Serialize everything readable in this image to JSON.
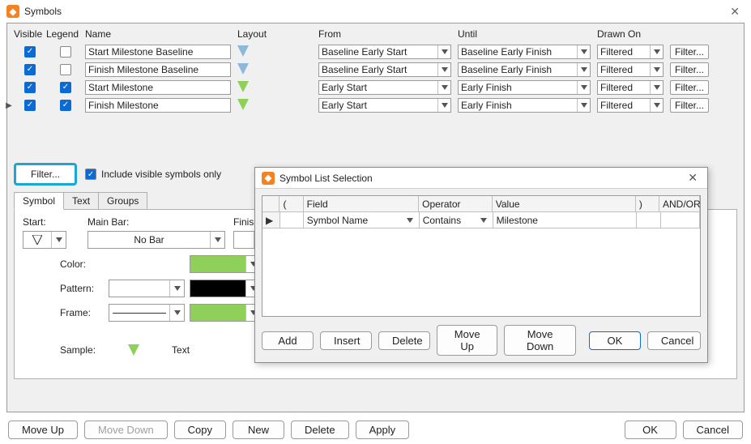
{
  "window": {
    "title": "Symbols",
    "close_icon": "✕"
  },
  "grid": {
    "headers": {
      "visible": "Visible",
      "legend": "Legend",
      "name": "Name",
      "layout": "Layout",
      "from": "From",
      "until": "Until",
      "drawn": "Drawn On"
    },
    "filter_btn": "Filter...",
    "rows": [
      {
        "visible": true,
        "legend": false,
        "name": "Start Milestone Baseline",
        "layout_color": "#8cb9d9",
        "from": "Baseline Early Start",
        "until": "Baseline Early Finish",
        "drawn": "Filtered"
      },
      {
        "visible": true,
        "legend": false,
        "name": "Finish Milestone Baseline",
        "layout_color": "#8cb9d9",
        "from": "Baseline Early Start",
        "until": "Baseline Early Finish",
        "drawn": "Filtered"
      },
      {
        "visible": true,
        "legend": true,
        "name": "Start Milestone",
        "layout_color": "#8ed05a",
        "from": "Early Start",
        "until": "Early Finish",
        "drawn": "Filtered"
      },
      {
        "visible": true,
        "legend": true,
        "name": "Finish Milestone",
        "layout_color": "#8ed05a",
        "from": "Early Start",
        "until": "Early Finish",
        "drawn": "Filtered"
      }
    ]
  },
  "filter": {
    "button": "Filter...",
    "include_label": "Include visible symbols only",
    "include_checked": true
  },
  "tabs": {
    "symbol": "Symbol",
    "text": "Text",
    "groups": "Groups",
    "active": "symbol"
  },
  "symbol_tab": {
    "start_label": "Start:",
    "mainbar_label": "Main Bar:",
    "finish_label": "Finish:",
    "mainbar_value": "No Bar",
    "color_label": "Color:",
    "pattern_label": "Pattern:",
    "frame_label": "Frame:",
    "color_swatch": "#8ed05a",
    "pattern_swatch_left": "#ffffff",
    "pattern_swatch_right": "#000000",
    "frame_swatch": "#8ed05a",
    "sample_label": "Sample:",
    "sample_text": "Text"
  },
  "footer": {
    "move_up": "Move Up",
    "move_down": "Move Down",
    "copy": "Copy",
    "new": "New",
    "delete": "Delete",
    "apply": "Apply",
    "ok": "OK",
    "cancel": "Cancel"
  },
  "dialog": {
    "title": "Symbol List Selection",
    "headers": {
      "p1": "(",
      "field": "Field",
      "operator": "Operator",
      "value": "Value",
      "p2": ")",
      "andor": "AND/OR"
    },
    "row": {
      "field": "Symbol Name",
      "operator": "Contains",
      "value": "Milestone"
    },
    "buttons": {
      "add": "Add",
      "insert": "Insert",
      "delete": "Delete",
      "move_up": "Move Up",
      "move_down": "Move Down",
      "ok": "OK",
      "cancel": "Cancel"
    }
  }
}
